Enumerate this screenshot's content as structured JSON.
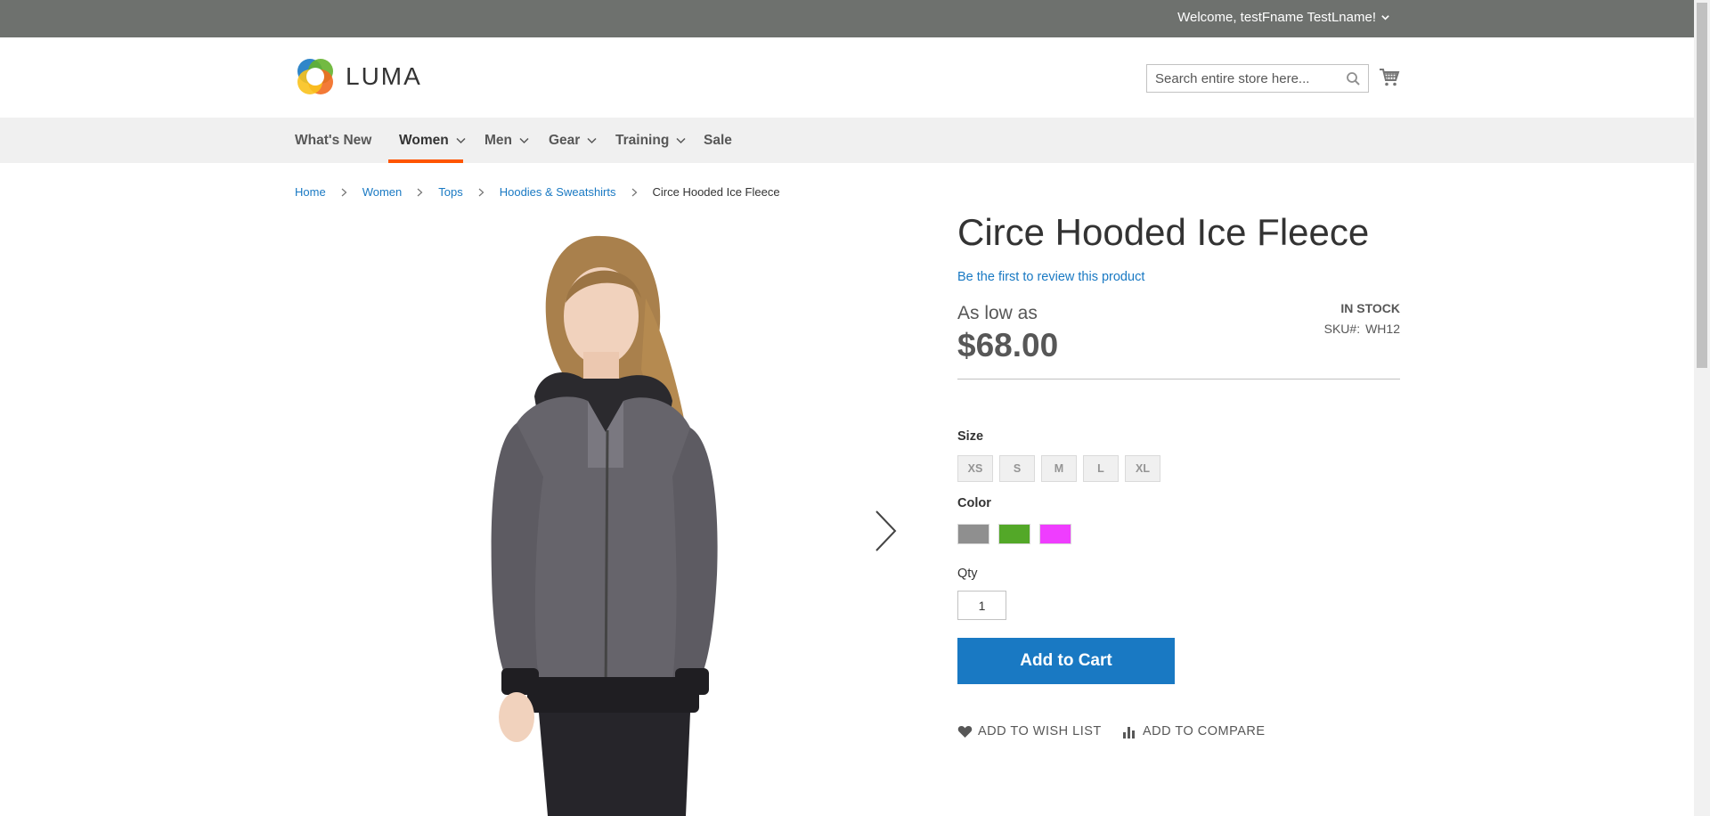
{
  "header": {
    "welcome": "Welcome, testFname TestLname!",
    "logo_text": "LUMA",
    "search_placeholder": "Search entire store here..."
  },
  "nav": {
    "items": [
      {
        "label": "What's New",
        "has_dropdown": false
      },
      {
        "label": "Women",
        "has_dropdown": true,
        "active": true
      },
      {
        "label": "Men",
        "has_dropdown": true
      },
      {
        "label": "Gear",
        "has_dropdown": true
      },
      {
        "label": "Training",
        "has_dropdown": true
      },
      {
        "label": "Sale",
        "has_dropdown": false
      }
    ],
    "active_color": "#ff5501"
  },
  "breadcrumbs": [
    "Home",
    "Women",
    "Tops",
    "Hoodies & Sweatshirts",
    "Circe Hooded Ice Fleece"
  ],
  "product": {
    "title": "Circe Hooded Ice Fleece",
    "review_link": "Be the first to review this product",
    "price_prefix": "As low as",
    "price": "$68.00",
    "stock": "IN STOCK",
    "sku_label": "SKU#:",
    "sku": "WH12"
  },
  "options": {
    "size_label": "Size",
    "sizes": [
      "XS",
      "S",
      "M",
      "L",
      "XL"
    ],
    "color_label": "Color",
    "colors": [
      "#8f8f8f",
      "#53a828",
      "#ef3dff"
    ],
    "qty_label": "Qty",
    "qty_value": "1"
  },
  "actions": {
    "add_to_cart": "Add to Cart",
    "wishlist": "ADD TO WISH LIST",
    "compare": "ADD TO COMPARE"
  },
  "icons": [
    "chevron-down-icon",
    "search-icon",
    "cart-icon",
    "chevron-right-icon",
    "heart-icon",
    "compare-chart-icon"
  ],
  "colors": {
    "topbar": "#6e716e",
    "link": "#1979c3",
    "button": "#1979c3",
    "nav_bg": "#f0f0f0"
  }
}
